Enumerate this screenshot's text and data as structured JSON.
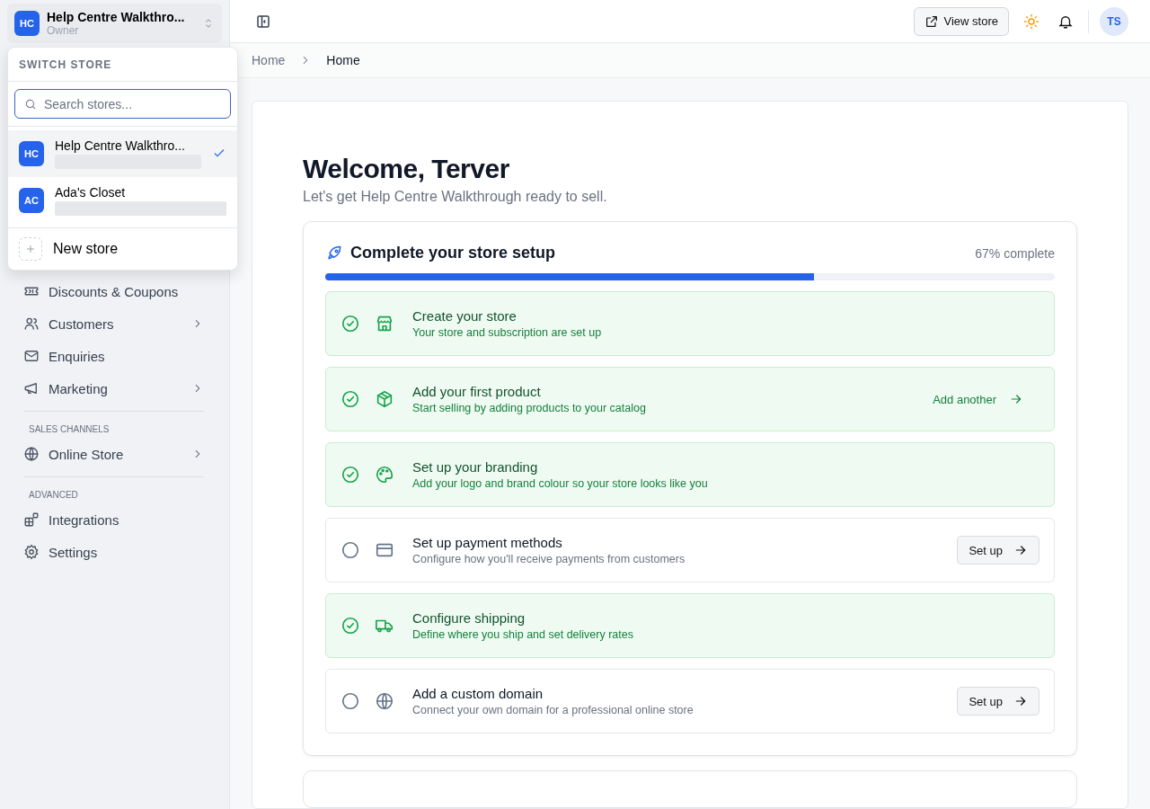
{
  "store_switcher": {
    "initials": "HC",
    "name": "Help Centre Walkthro...",
    "role": "Owner"
  },
  "dropdown": {
    "heading": "SWITCH STORE",
    "search": {
      "placeholder": "Search stores..."
    },
    "stores": [
      {
        "initials": "HC",
        "name": "Help Centre Walkthro...",
        "selected": true
      },
      {
        "initials": "AC",
        "name": "Ada's Closet",
        "selected": false
      }
    ],
    "new_store": "New store"
  },
  "sidebar": {
    "sections": [
      {
        "items": [
          {
            "label": "Discounts & Coupons",
            "has_children": false
          },
          {
            "label": "Customers",
            "has_children": true
          },
          {
            "label": "Enquiries",
            "has_children": false
          },
          {
            "label": "Marketing",
            "has_children": true
          }
        ]
      },
      {
        "heading": "SALES CHANNELS",
        "items": [
          {
            "label": "Online Store",
            "has_children": true
          }
        ]
      },
      {
        "heading": "ADVANCED",
        "items": [
          {
            "label": "Integrations",
            "has_children": false
          },
          {
            "label": "Settings",
            "has_children": false
          }
        ]
      }
    ]
  },
  "topbar": {
    "view_store": "View store",
    "user_initials": "TS"
  },
  "breadcrumbs": [
    {
      "label": "Home",
      "current": false
    },
    {
      "label": "Home",
      "current": true
    }
  ],
  "welcome": {
    "title": "Welcome, Terver",
    "subtitle": "Let's get Help Centre Walkthrough ready to sell."
  },
  "setup": {
    "title": "Complete your store setup",
    "progress_text": "67% complete",
    "level": 0.67,
    "steps": [
      {
        "title": "Create your store",
        "description": "Your store and subscription are set up",
        "completed": true
      },
      {
        "title": "Add your first product",
        "description": "Start selling by adding products to your catalog",
        "completed": true,
        "action": {
          "kind": "link",
          "label": "Add another"
        }
      },
      {
        "title": "Set up your branding",
        "description": "Add your logo and brand colour so your store looks like you",
        "completed": true
      },
      {
        "title": "Set up payment methods",
        "description": "Configure how you'll receive payments from customers",
        "completed": false,
        "action": {
          "kind": "button",
          "label": "Set up"
        }
      },
      {
        "title": "Configure shipping",
        "description": "Define where you ship and set delivery rates",
        "completed": true
      },
      {
        "title": "Add a custom domain",
        "description": "Connect your own domain for a professional online store",
        "completed": false,
        "action": {
          "kind": "button",
          "label": "Set up"
        }
      }
    ]
  }
}
